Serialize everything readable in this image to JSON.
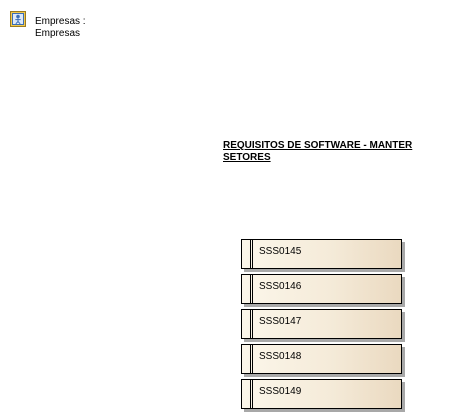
{
  "actor": {
    "icon": "actor-frame-icon",
    "line1": "Empresas :",
    "line2": "Empresas"
  },
  "diagram": {
    "title_line1": "REQUISITOS DE SOFTWARE - MANTER",
    "title_line2": "SETORES"
  },
  "packages": [
    {
      "label": "SSS0145"
    },
    {
      "label": "SSS0146"
    },
    {
      "label": "SSS0147"
    },
    {
      "label": "SSS0148"
    },
    {
      "label": "SSS0149"
    }
  ]
}
